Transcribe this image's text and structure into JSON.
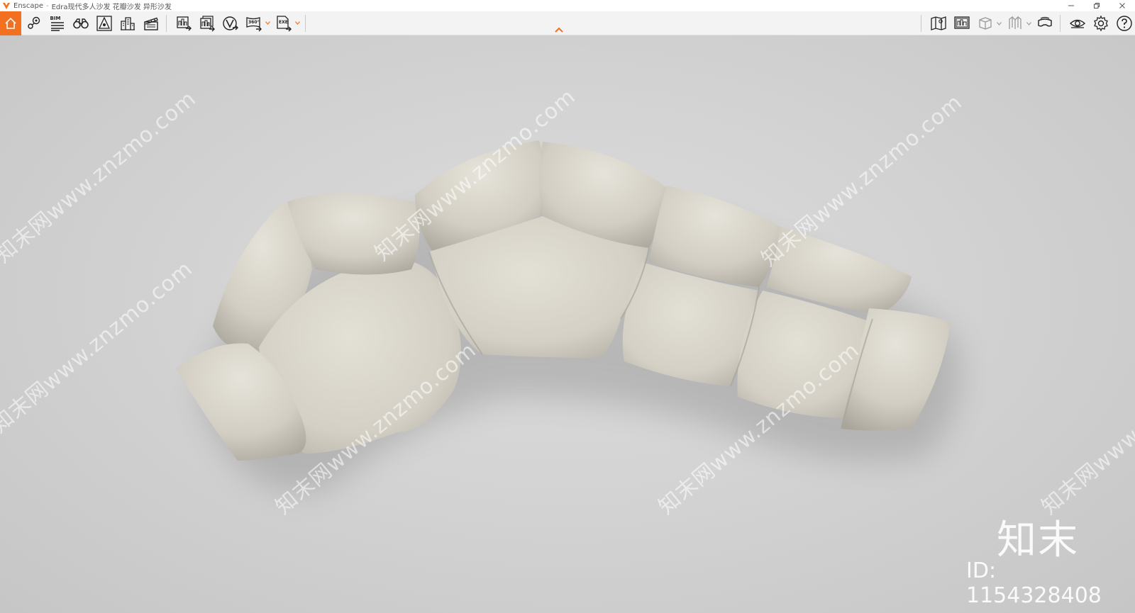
{
  "window": {
    "app_name": "Enscape",
    "separator": "-",
    "document_title": "Edra现代多人沙发 花瓣沙发 异形沙发",
    "controls": [
      "minimize-icon",
      "restore-icon",
      "close-icon"
    ]
  },
  "toolbar": {
    "accent_color": "#f37021",
    "left_icons": [
      "home-icon",
      "map-pin-icon",
      "bim-icon",
      "binoculars-icon",
      "perspective-icon",
      "buildings-icon",
      "clapper-icon"
    ],
    "bim_label": "BIM",
    "export_icons": [
      "screenshot-export-icon",
      "batch-export-icon",
      "vr-export-icon",
      "panorama-export-icon",
      "exe-export-icon"
    ],
    "panorama_label": "360°",
    "exe_label": "EXE",
    "right_icons": [
      "map-icon",
      "minimap-icon",
      "view-cube-icon",
      "section-icon",
      "vr-headset-icon",
      "eye-icon",
      "settings-icon",
      "help-icon"
    ],
    "collapse_icon": "chevron-up-icon"
  },
  "viewport": {
    "scene": "top view of a curved multi-seat petal sofa",
    "watermark_text": "知末网www.znzmo.com",
    "brand_mark": "知末",
    "image_id": "ID: 1154328408"
  }
}
